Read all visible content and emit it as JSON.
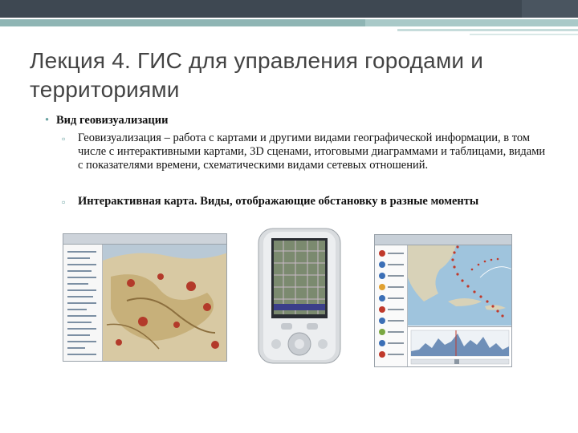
{
  "slide": {
    "title": "Лекция 4. ГИС для управления городами и территориями",
    "bullet": {
      "text": "Вид геовизуализации",
      "subitems": [
        "Геовизуализация – работа с картами и другими видами географической информации, в том числе с интерактивными картами, 3D сценами, итоговыми диаграммами и таблицами, видами с показателями времени, схематическими видами сетевых отношений.",
        "Интерактивная карта. Виды, отображающие обстановку в разные моменты"
      ]
    }
  },
  "colors": {
    "header_dark": "#3e4852",
    "header_teal": "#8fb5b4",
    "bullet_accent": "#6aa3a2",
    "title_text": "#434343"
  }
}
